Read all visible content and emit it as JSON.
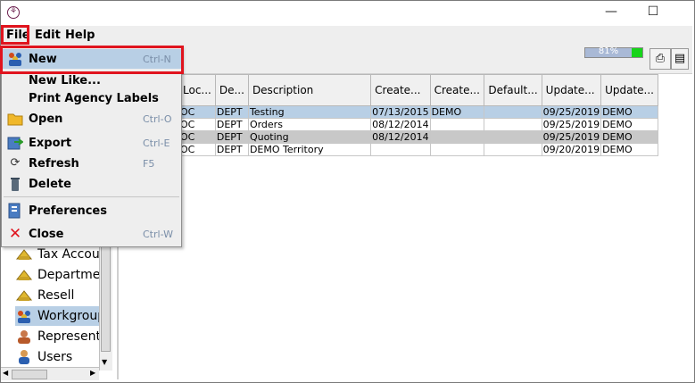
{
  "window": {
    "minimize_glyph": "—",
    "maximize_glyph": "☐"
  },
  "menubar": {
    "file": "File",
    "edit": "Edit",
    "help": "Help"
  },
  "toolbar": {
    "progress_text": "81%",
    "progress_value": 0.81
  },
  "file_menu": {
    "items": [
      {
        "label": "New",
        "accel": "Ctrl-N",
        "icon": "people-icon"
      },
      {
        "label": "New Like...",
        "accel": "",
        "icon": ""
      },
      {
        "label": "Print Agency Labels",
        "accel": "",
        "icon": ""
      },
      {
        "label": "Open",
        "accel": "Ctrl-O",
        "icon": "folder-icon"
      },
      {
        "label": "Export",
        "accel": "Ctrl-E",
        "icon": "export-icon"
      },
      {
        "label": "Refresh",
        "accel": "F5",
        "icon": "refresh-icon"
      },
      {
        "label": "Delete",
        "accel": "",
        "icon": "trash-icon"
      },
      {
        "label": "Preferences",
        "accel": "",
        "icon": "preferences-icon"
      },
      {
        "label": "Close",
        "accel": "Ctrl-W",
        "icon": "close-icon"
      }
    ]
  },
  "tree": {
    "items": [
      "Tax Accou",
      "Departmer",
      "Resell",
      "Workgroup",
      "Representi",
      "Users"
    ]
  },
  "table": {
    "columns": [
      "Loc...",
      "De...",
      "Description",
      "Create...",
      "Create...",
      "Default...",
      "Update...",
      "Update..."
    ],
    "rows": [
      [
        "OC",
        "DEPT",
        "Testing",
        "07/13/2015",
        "DEMO",
        "",
        "09/25/2019",
        "DEMO"
      ],
      [
        "OC",
        "DEPT",
        "Orders",
        "08/12/2014",
        "",
        "",
        "09/25/2019",
        "DEMO"
      ],
      [
        "OC",
        "DEPT",
        "Quoting",
        "08/12/2014",
        "",
        "",
        "09/25/2019",
        "DEMO"
      ],
      [
        "OC",
        "DEPT",
        "DEMO Territory",
        "",
        "",
        "",
        "09/20/2019",
        "DEMO"
      ]
    ]
  },
  "colors": {
    "accent_red": "#e0141e",
    "selection": "#b8cfe5",
    "progress_green": "#16d41a"
  }
}
